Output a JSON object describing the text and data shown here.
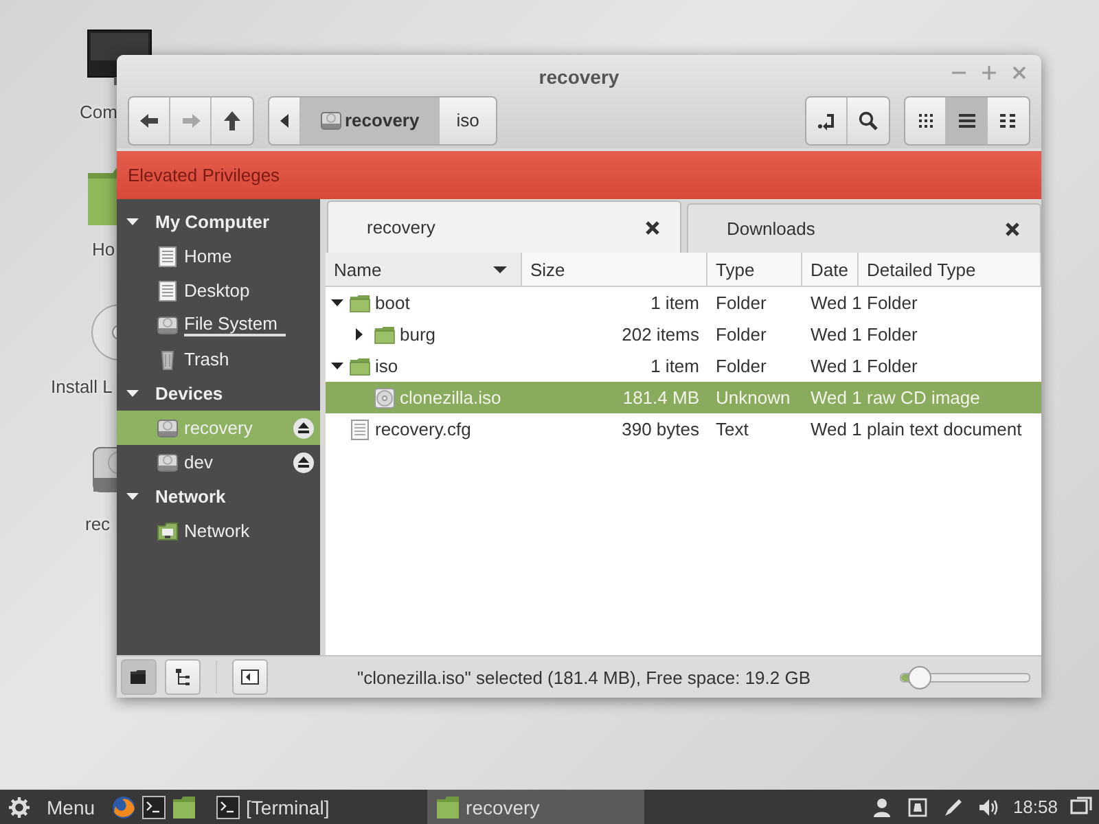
{
  "desktop_icons": [
    {
      "label": "Com",
      "kind": "monitor"
    },
    {
      "label": "Ho",
      "kind": "home"
    },
    {
      "label": "Install L",
      "kind": "disc"
    },
    {
      "label": "rec",
      "kind": "drive"
    }
  ],
  "window": {
    "title": "recovery"
  },
  "toolbar": {
    "nav": [
      {
        "kind": "back",
        "disabled": false
      },
      {
        "kind": "forward",
        "disabled": true
      },
      {
        "kind": "up",
        "disabled": false
      }
    ],
    "breadcrumb": [
      {
        "label": "recovery",
        "kind": "drive",
        "selected": true
      },
      {
        "label": "iso",
        "kind": "plain",
        "selected": false
      }
    ],
    "actions": [
      {
        "kind": "location"
      },
      {
        "kind": "search"
      }
    ],
    "view_modes": [
      {
        "kind": "icons",
        "selected": false
      },
      {
        "kind": "list",
        "selected": true
      },
      {
        "kind": "compact",
        "selected": false
      }
    ]
  },
  "banner": {
    "text": "Elevated Privileges"
  },
  "sidebar": {
    "sections": [
      {
        "title": "My Computer",
        "expanded": true,
        "items": [
          {
            "label": "Home",
            "kind": "document",
            "selected": false,
            "underlined": false,
            "ejectable": false
          },
          {
            "label": "Desktop",
            "kind": "document",
            "selected": false,
            "underlined": false,
            "ejectable": false
          },
          {
            "label": "File System",
            "kind": "drive",
            "selected": false,
            "underlined": true,
            "ejectable": false
          },
          {
            "label": "Trash",
            "kind": "trash",
            "selected": false,
            "underlined": false,
            "ejectable": false
          }
        ]
      },
      {
        "title": "Devices",
        "expanded": true,
        "items": [
          {
            "label": "recovery",
            "kind": "drive",
            "selected": true,
            "underlined": false,
            "ejectable": true
          },
          {
            "label": "dev",
            "kind": "drive",
            "selected": false,
            "underlined": false,
            "ejectable": true
          }
        ]
      },
      {
        "title": "Network",
        "expanded": true,
        "items": [
          {
            "label": "Network",
            "kind": "network",
            "selected": false,
            "underlined": false,
            "ejectable": false
          }
        ]
      }
    ]
  },
  "tabs": [
    {
      "label": "recovery",
      "selected": true
    },
    {
      "label": "Downloads",
      "selected": false
    }
  ],
  "table": {
    "columns": [
      {
        "label": "Name",
        "sorted": true
      },
      {
        "label": "Size",
        "sorted": false
      },
      {
        "label": "Type",
        "sorted": false
      },
      {
        "label": "Date",
        "sorted": false
      },
      {
        "label": "Detailed Type",
        "sorted": false
      }
    ],
    "rows": [
      {
        "name": "boot",
        "kind": "folder",
        "expanded": true,
        "selected": false,
        "size": "1 item",
        "type": "Folder",
        "date": "Wed 1",
        "detailed_type": "Folder",
        "children": [
          {
            "name": "burg",
            "kind": "folder",
            "expanded": false,
            "selected": false,
            "size": "202 items",
            "type": "Folder",
            "date": "Wed 1",
            "detailed_type": "Folder"
          }
        ]
      },
      {
        "name": "iso",
        "kind": "folder",
        "expanded": true,
        "selected": false,
        "size": "1 item",
        "type": "Folder",
        "date": "Wed 1",
        "detailed_type": "Folder",
        "children": [
          {
            "name": "clonezilla.iso",
            "kind": "disc",
            "selected": true,
            "size": "181.4 MB",
            "type": "Unknown",
            "date": "Wed 1",
            "detailed_type": "raw CD image"
          }
        ]
      },
      {
        "name": "recovery.cfg",
        "kind": "text",
        "selected": false,
        "size": "390 bytes",
        "type": "Text",
        "date": "Wed 1",
        "detailed_type": "plain text document"
      }
    ]
  },
  "status_bar": {
    "panes": [
      {
        "kind": "places",
        "selected": true
      },
      {
        "kind": "tree",
        "selected": false
      }
    ],
    "text": "\"clonezilla.iso\" selected (181.4 MB), Free space: 19.2 GB",
    "zoom": {
      "level": 0.08
    }
  },
  "taskbar": {
    "menu_label": "Menu",
    "launchers": [
      {
        "kind": "browser"
      },
      {
        "kind": "terminal"
      },
      {
        "kind": "folder"
      }
    ],
    "windows": [
      {
        "label": "[Terminal]",
        "kind": "terminal",
        "selected": false
      },
      {
        "label": "recovery",
        "kind": "folder",
        "selected": true
      }
    ],
    "tray": [
      {
        "kind": "user"
      },
      {
        "kind": "update"
      },
      {
        "kind": "pen"
      },
      {
        "kind": "volume"
      }
    ],
    "clock": "18:58"
  }
}
